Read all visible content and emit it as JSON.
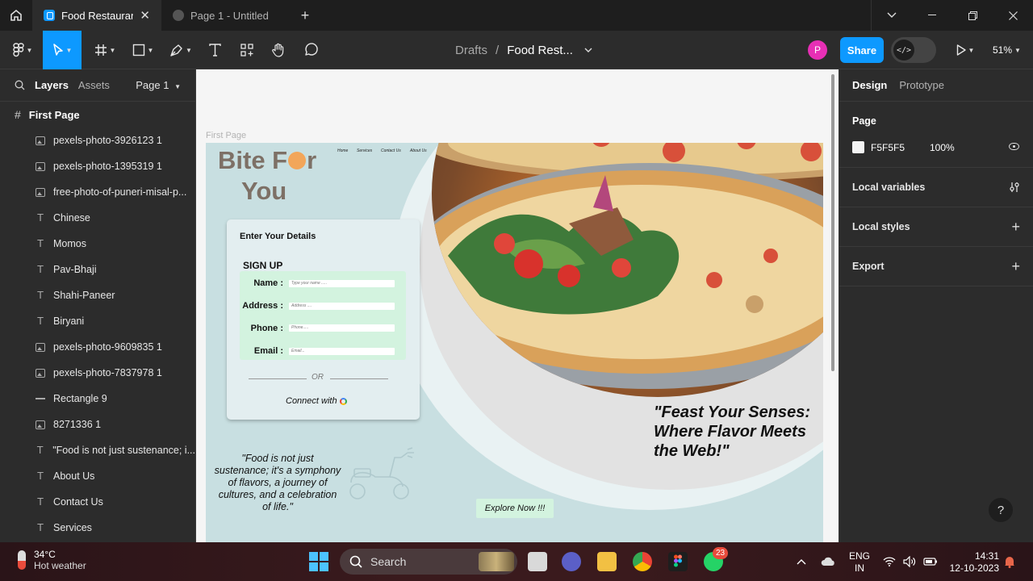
{
  "titlebar": {
    "tabs": [
      {
        "label": "Food Restaurant",
        "active": true
      },
      {
        "label": "Page 1 - Untitled",
        "active": false
      }
    ]
  },
  "toolbar": {
    "breadcrumb_root": "Drafts",
    "breadcrumb_sep": "/",
    "file_name": "Food Rest...",
    "avatar_initial": "P",
    "share_label": "Share",
    "zoom": "51%"
  },
  "left_panel": {
    "tab_layers": "Layers",
    "tab_assets": "Assets",
    "page_selector": "Page 1",
    "frame_name": "First Page",
    "layers": [
      {
        "name": "pexels-photo-3926123 1",
        "kind": "image"
      },
      {
        "name": "pexels-photo-1395319 1",
        "kind": "image"
      },
      {
        "name": "free-photo-of-puneri-misal-p...",
        "kind": "image"
      },
      {
        "name": "Chinese",
        "kind": "text"
      },
      {
        "name": "Momos",
        "kind": "text"
      },
      {
        "name": "Pav-Bhaji",
        "kind": "text"
      },
      {
        "name": "Shahi-Paneer",
        "kind": "text"
      },
      {
        "name": "Biryani",
        "kind": "text"
      },
      {
        "name": "pexels-photo-9609835 1",
        "kind": "image"
      },
      {
        "name": "pexels-photo-7837978 1",
        "kind": "image"
      },
      {
        "name": "Rectangle 9",
        "kind": "rectangle"
      },
      {
        "name": "8271336 1",
        "kind": "image"
      },
      {
        "name": "\"Food is not just sustenance; i...",
        "kind": "text"
      },
      {
        "name": "About Us",
        "kind": "text"
      },
      {
        "name": "Contact Us",
        "kind": "text"
      },
      {
        "name": "Services",
        "kind": "text"
      }
    ]
  },
  "canvas": {
    "frame_label": "First Page",
    "design": {
      "logo_line1_pre": "Bite F",
      "logo_line1_post": "r",
      "logo_line2": "You",
      "nav": [
        "Home",
        "Services",
        "Contact Us",
        "About Us"
      ],
      "card_title": "Enter Your Details",
      "signup_title": "SIGN UP",
      "fields": [
        {
          "label": "Name :",
          "placeholder": "Type your name ....."
        },
        {
          "label": "Address :",
          "placeholder": "Address ...."
        },
        {
          "label": "Phone :",
          "placeholder": "Phone....."
        },
        {
          "label": "Email :",
          "placeholder": "Email..."
        }
      ],
      "or_text": "OR",
      "connect_text": "Connect with",
      "quote": "\"Food is not just sustenance; it's a symphony of flavors, a journey of cultures, and a celebration of life.\"",
      "tagline": "\"Feast Your Senses: Where Flavor Meets the Web!\"",
      "explore_label": "Explore Now !!!"
    }
  },
  "right_panel": {
    "tab_design": "Design",
    "tab_prototype": "Prototype",
    "page_section_title": "Page",
    "page_color_hex": "F5F5F5",
    "page_opacity": "100%",
    "local_variables": "Local variables",
    "local_styles": "Local styles",
    "export": "Export",
    "help": "?"
  },
  "taskbar": {
    "temperature": "34°C",
    "weather": "Hot weather",
    "search_label": "Search",
    "whatsapp_badge": "23",
    "lang_line1": "ENG",
    "lang_line2": "IN",
    "time": "14:31",
    "date": "12-10-2023"
  },
  "colors": {
    "accent": "#0d99ff",
    "canvas_bg": "#f5f5f5",
    "design_bg": "#c8dfe1",
    "form_green": "#d3f3df",
    "avatar": "#e72fb5"
  }
}
